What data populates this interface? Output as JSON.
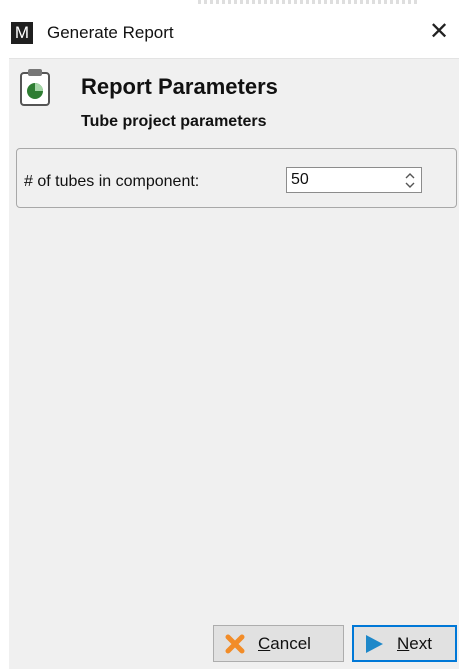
{
  "window": {
    "title": "Generate Report",
    "app_icon_letter": "M",
    "close_glyph": "✕"
  },
  "header": {
    "icon": "clipboard-pie-chart-icon",
    "title": "Report Parameters",
    "subtitle": "Tube project parameters"
  },
  "parameters": {
    "tubes_label": "# of tubes in component:",
    "tubes_value": "50"
  },
  "buttons": {
    "cancel": {
      "mnemonic": "C",
      "rest": "ancel",
      "icon": "x-icon"
    },
    "next": {
      "mnemonic": "N",
      "rest": "ext",
      "icon": "play-arrow-icon"
    }
  },
  "colors": {
    "cancel_icon": "#f28c28",
    "next_icon": "#1e88c9",
    "pie_green": "#2e7d32",
    "focus_border": "#0078d7"
  }
}
